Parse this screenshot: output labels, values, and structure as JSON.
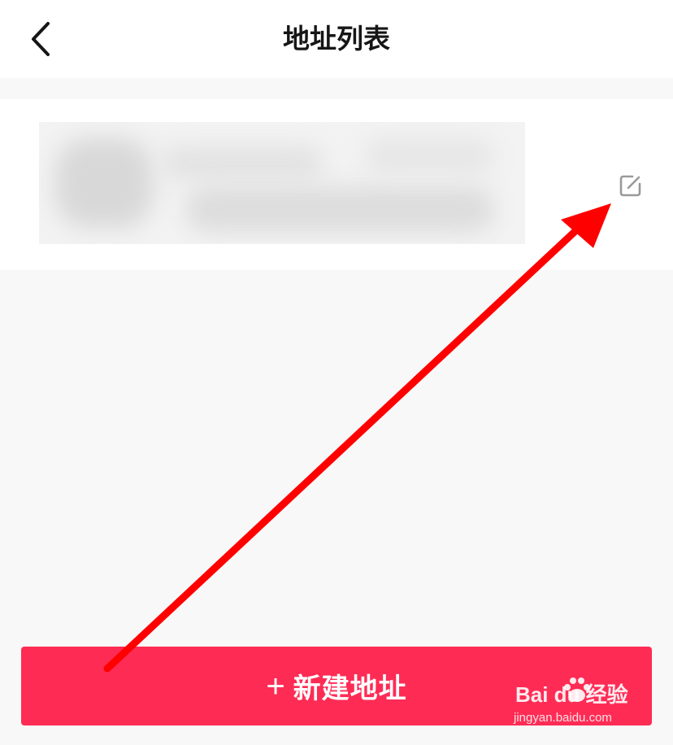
{
  "header": {
    "title": "地址列表",
    "back_icon": "chevron-left-icon"
  },
  "address_list": {
    "items": [
      {
        "content": "",
        "edit_icon": "edit-icon"
      }
    ]
  },
  "footer": {
    "new_address_icon": "+",
    "new_address_label": "新建地址"
  },
  "watermark": {
    "brand": "Bai du 经验",
    "site": "jingyan.baidu.com"
  },
  "colors": {
    "accent": "#fe2c55",
    "annotation_arrow": "#ff0000",
    "background": "#f8f8f8",
    "card": "#ffffff"
  }
}
